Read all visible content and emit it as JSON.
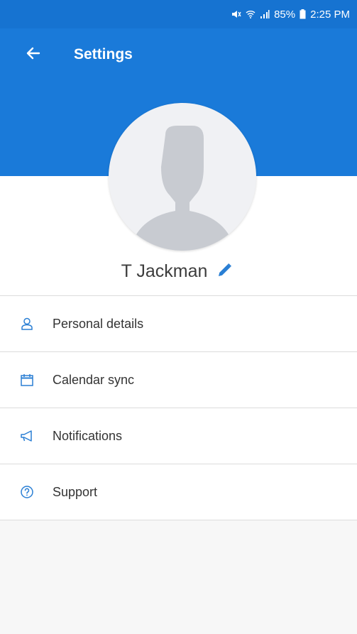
{
  "status_bar": {
    "battery": "85%",
    "time": "2:25 PM"
  },
  "app_bar": {
    "title": "Settings"
  },
  "profile": {
    "name": "T Jackman"
  },
  "menu": {
    "items": [
      {
        "label": "Personal details",
        "icon": "person-icon"
      },
      {
        "label": "Calendar sync",
        "icon": "calendar-icon"
      },
      {
        "label": "Notifications",
        "icon": "megaphone-icon"
      },
      {
        "label": "Support",
        "icon": "help-circle-icon"
      }
    ]
  },
  "colors": {
    "primary": "#1a7ad9",
    "status_bar": "#1673d1",
    "icon_accent": "#2a7fd4",
    "avatar_bg": "#f0f1f4",
    "avatar_silhouette": "#c8cbd1",
    "divider": "#dcdcdc",
    "footer_bg": "#f7f7f7"
  }
}
